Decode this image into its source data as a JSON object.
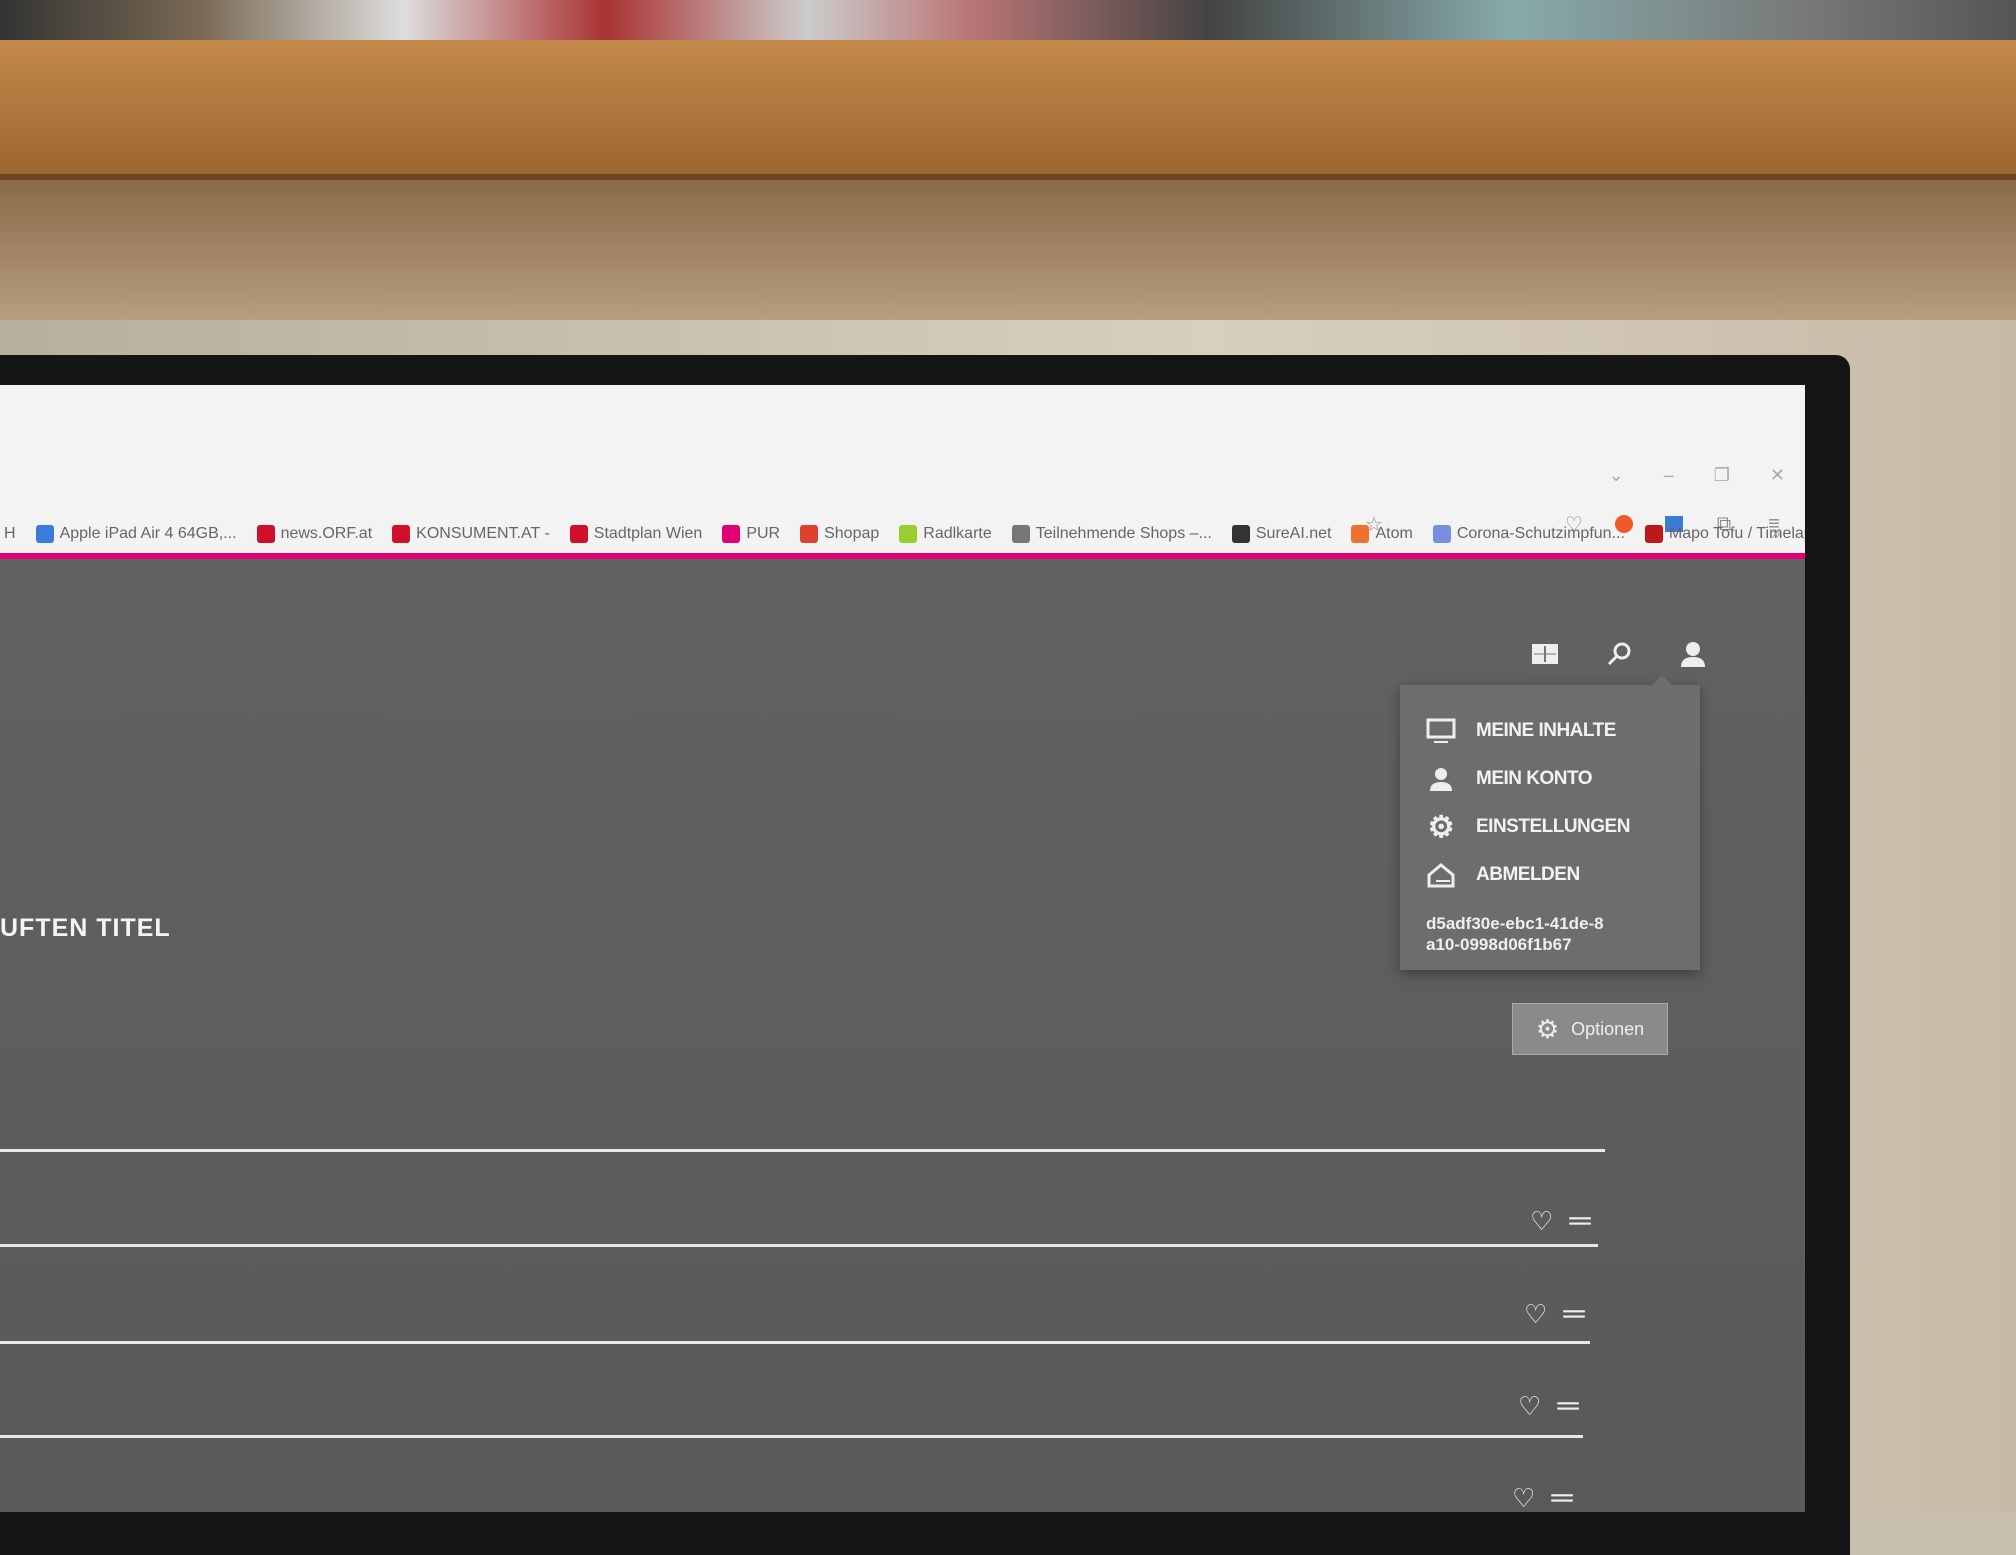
{
  "browser": {
    "bookmarks": [
      {
        "label": "H",
        "color": "#888888"
      },
      {
        "label": "Apple iPad Air 4 64GB,...",
        "color": "#3b7bdc"
      },
      {
        "label": "news.ORF.at",
        "color": "#d0102a"
      },
      {
        "label": "KONSUMENT.AT -",
        "color": "#d0102a"
      },
      {
        "label": "Stadtplan Wien",
        "color": "#d0102a"
      },
      {
        "label": "PUR",
        "color": "#e20074"
      },
      {
        "label": "Shopap",
        "color": "#e04030"
      },
      {
        "label": "Radlkarte",
        "color": "#9acd32"
      },
      {
        "label": "Teilnehmende Shops –...",
        "color": "#777777"
      },
      {
        "label": "SureAI.net",
        "color": "#333333"
      },
      {
        "label": "Atom",
        "color": "#f07030"
      },
      {
        "label": "Corona-Schutzimpfun...",
        "color": "#7a8ee0"
      },
      {
        "label": "Mapo Tofu / Timelaps...",
        "color": "#c01818"
      }
    ],
    "overflow": "»",
    "accent": "#e20074"
  },
  "header": {
    "icons": [
      "epg-grid-icon",
      "search-icon",
      "user-icon"
    ]
  },
  "user_menu": {
    "items": [
      {
        "label": "MEINE INHALTE",
        "icon": "monitor-icon"
      },
      {
        "label": "MEIN KONTO",
        "icon": "user-icon"
      },
      {
        "label": "EINSTELLUNGEN",
        "icon": "gear-icon"
      },
      {
        "label": "ABMELDEN",
        "icon": "logout-house-icon"
      }
    ],
    "user_id": "d5adf30e-ebc1-41de-8a10-0998d06f1b67"
  },
  "main": {
    "section_title": "UFTEN TITEL",
    "options_label": "Optionen"
  }
}
